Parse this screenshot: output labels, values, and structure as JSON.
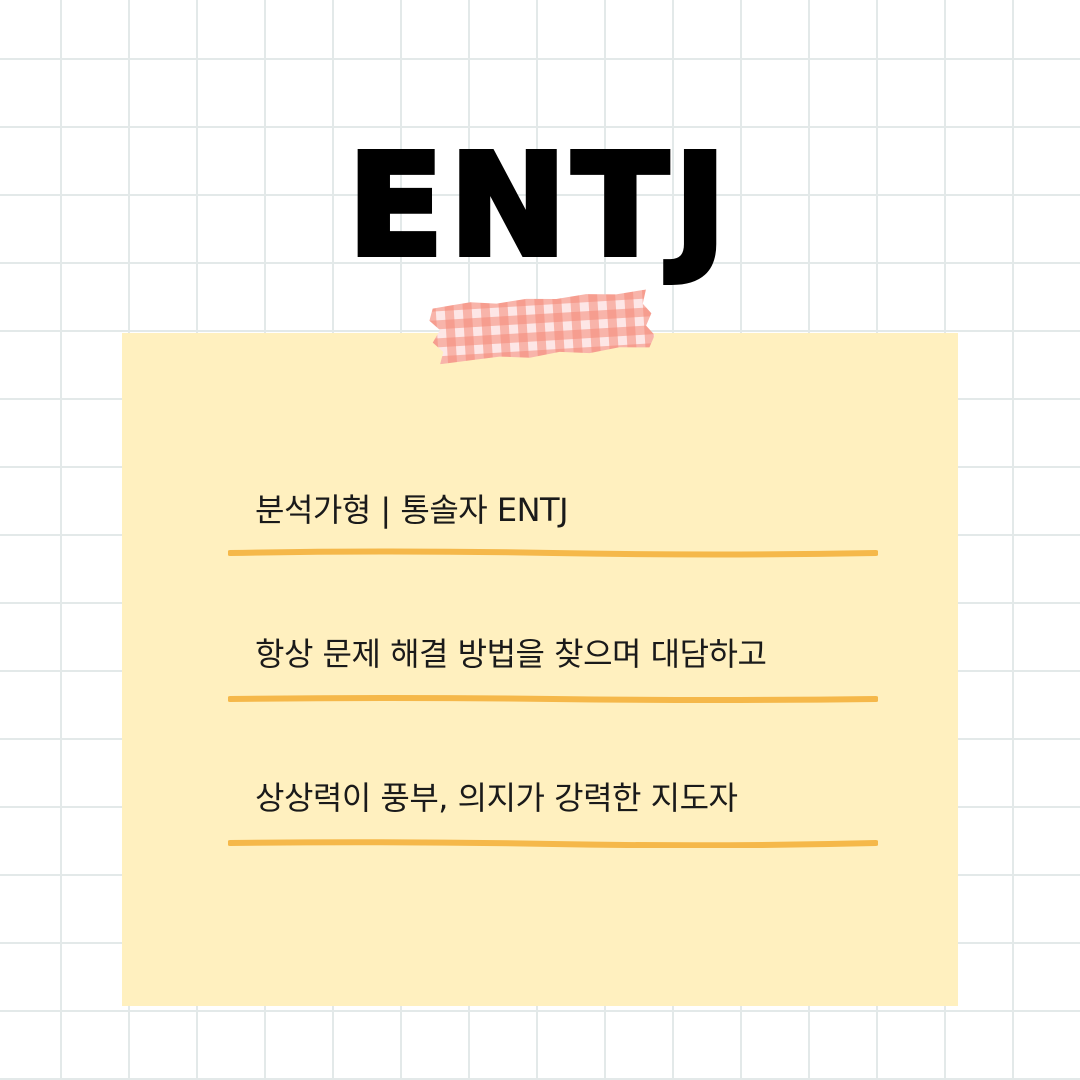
{
  "title": "ENTJ",
  "lines": [
    "분석가형 |  통솔자 ENTJ",
    "항상 문제 해결 방법을 찾으며 대담하고",
    "상상력이 풍부, 의지가 강력한 지도자"
  ],
  "colors": {
    "grid": "#e3e9e9",
    "note": "#fff0bf",
    "underline": "#f5b84a",
    "tape": "#f38b78"
  }
}
